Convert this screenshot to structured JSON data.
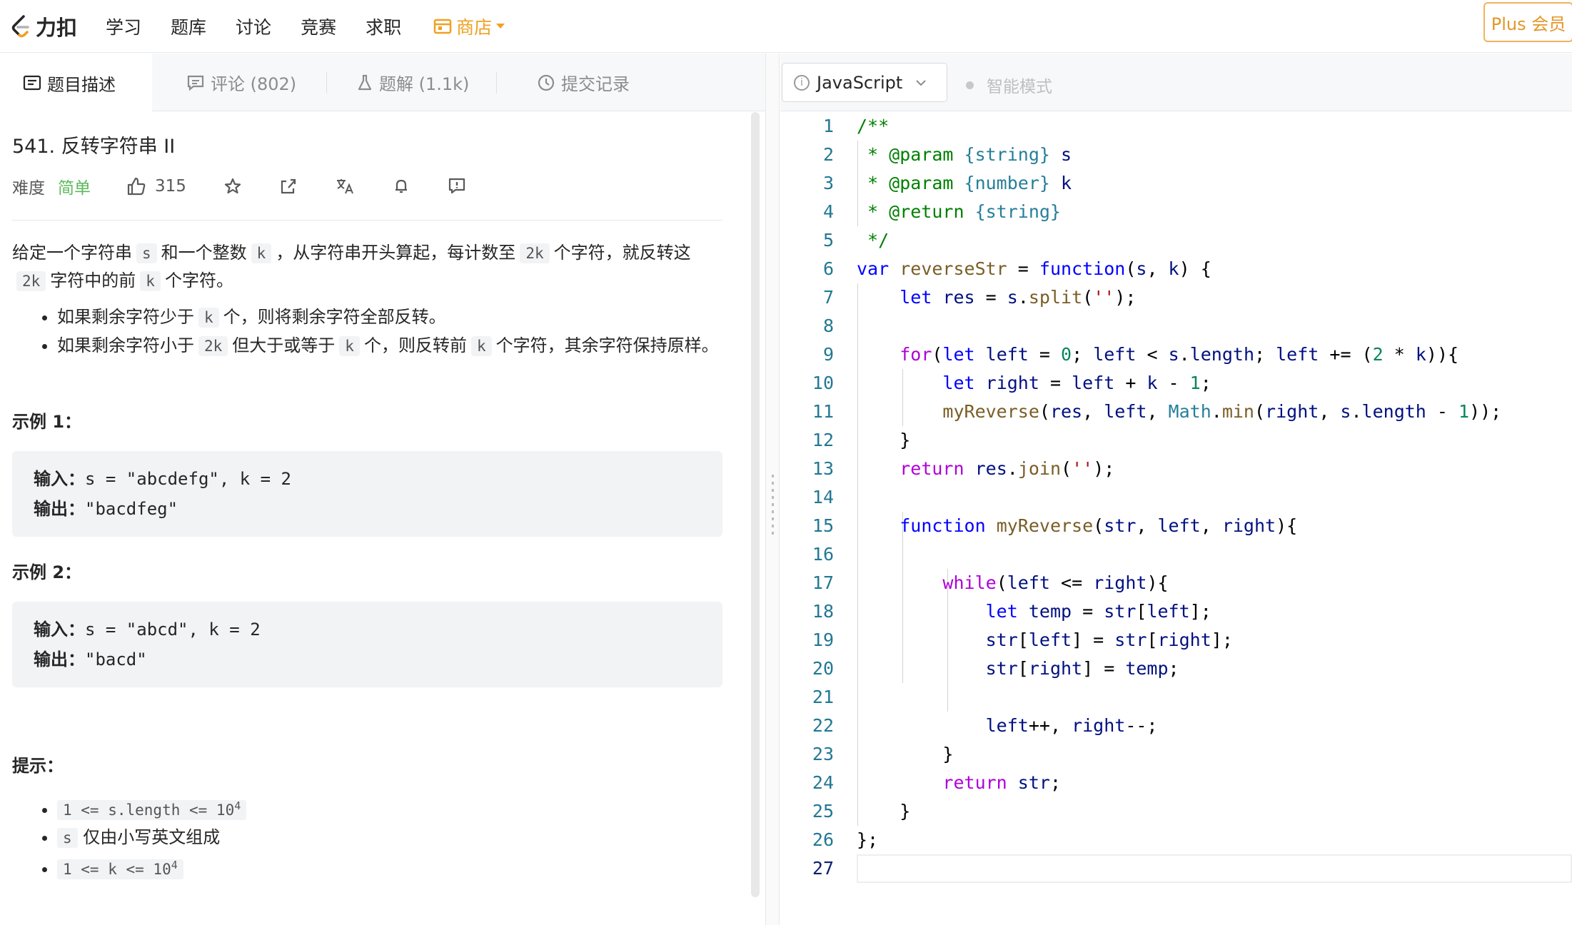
{
  "nav": {
    "logo_text": "力扣",
    "items": [
      "学习",
      "题库",
      "讨论",
      "竞赛",
      "求职"
    ],
    "store_label": "商店",
    "plus_label": "Plus 会员"
  },
  "tabs": {
    "description": "题目描述",
    "comments": "评论 (802)",
    "solutions": "题解 (1.1k)",
    "submissions": "提交记录"
  },
  "problem": {
    "title": "541. 反转字符串 II",
    "difficulty_label": "难度",
    "difficulty": "简单",
    "likes": "315",
    "desc_p1": "给定一个字符串",
    "desc_p2": "和一个整数",
    "desc_p3": "，从字符串开头算起，每计数至",
    "desc_p4": "个字符，就反转这",
    "desc_p5": "字符中的前",
    "desc_p6": "个字符。",
    "code_s": "s",
    "code_k": "k",
    "code_2k": "2k",
    "bullet1_a": "如果剩余字符少于",
    "bullet1_b": "个，则将剩余字符全部反转。",
    "bullet2_a": "如果剩余字符小于",
    "bullet2_b": "但大于或等于",
    "bullet2_c": "个，则反转前",
    "bullet2_d": "个字符，其余字符保持原样。",
    "example1_title": "示例 1：",
    "example1_input_label": "输入：",
    "example1_input": "s = \"abcdefg\", k = 2",
    "example1_output_label": "输出：",
    "example1_output": "\"bacdfeg\"",
    "example2_title": "示例 2：",
    "example2_input_label": "输入：",
    "example2_input": "s = \"abcd\", k = 2",
    "example2_output_label": "输出：",
    "example2_output": "\"bacd\"",
    "hint_title": "提示：",
    "hint1": "1 <= s.length <= 10",
    "hint1_sup": "4",
    "hint2_code": "s",
    "hint2_text": "仅由小写英文组成",
    "hint3": "1 <= k <= 10",
    "hint3_sup": "4"
  },
  "editor": {
    "language": "JavaScript",
    "smart_mode": "智能模式",
    "line_numbers": [
      "1",
      "2",
      "3",
      "4",
      "5",
      "6",
      "7",
      "8",
      "9",
      "10",
      "11",
      "12",
      "13",
      "14",
      "15",
      "16",
      "17",
      "18",
      "19",
      "20",
      "21",
      "22",
      "23",
      "24",
      "25",
      "26",
      "27"
    ]
  }
}
